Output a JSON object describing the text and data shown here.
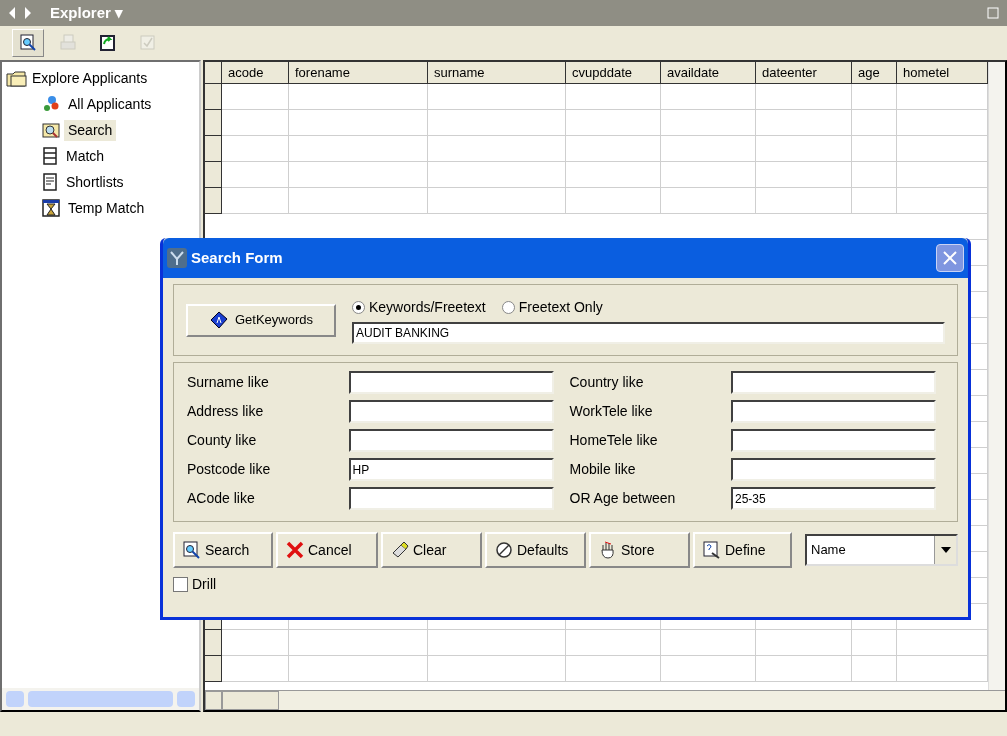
{
  "window": {
    "title": "Explorer ▾"
  },
  "toolbar": [
    {
      "kind": "search",
      "selected": true,
      "disabled": false
    },
    {
      "kind": "print",
      "selected": false,
      "disabled": true
    },
    {
      "kind": "refresh",
      "selected": false,
      "disabled": false
    },
    {
      "kind": "check",
      "selected": false,
      "disabled": true
    }
  ],
  "tree": {
    "label": "Explore Applicants",
    "children": [
      {
        "label": "All Applicants",
        "kind": "molecule",
        "selected": false
      },
      {
        "label": "Search",
        "kind": "search",
        "selected": true
      },
      {
        "label": "Match",
        "kind": "match",
        "selected": false
      },
      {
        "label": "Shortlists",
        "kind": "list",
        "selected": false
      },
      {
        "label": "Temp Match",
        "kind": "hourglass",
        "selected": false
      }
    ]
  },
  "table": {
    "columns": [
      "acode",
      "forename",
      "surname",
      "cvupddate",
      "availdate",
      "dateenter",
      "age",
      "hometel"
    ]
  },
  "dialog": {
    "title": "Search Form",
    "get_keywords": "GetKeywords",
    "modes": [
      {
        "label": "Keywords/Freetext",
        "selected": true
      },
      {
        "label": "Freetext Only",
        "selected": false
      }
    ],
    "keywords": "AUDIT BANKING",
    "fields_left": [
      {
        "label": "Surname like"
      },
      {
        "label": "Address like"
      },
      {
        "label": "County like"
      },
      {
        "label": "Postcode like",
        "value": "HP"
      },
      {
        "label": "ACode like"
      }
    ],
    "fields_right": [
      {
        "label": "Country like"
      },
      {
        "label": "WorkTele like"
      },
      {
        "label": "HomeTele like"
      },
      {
        "label": "Mobile like"
      },
      {
        "label": "OR Age between",
        "value": "25-35"
      }
    ],
    "buttons": [
      {
        "kind": "search",
        "label": "Search"
      },
      {
        "kind": "cancel",
        "label": "Cancel"
      },
      {
        "kind": "clear",
        "label": "Clear"
      },
      {
        "kind": "defaults",
        "label": "Defaults"
      },
      {
        "kind": "store",
        "label": "Store"
      },
      {
        "kind": "define",
        "label": "Define"
      }
    ],
    "sort": "Name",
    "drill": {
      "label": "Drill",
      "checked": false
    }
  }
}
